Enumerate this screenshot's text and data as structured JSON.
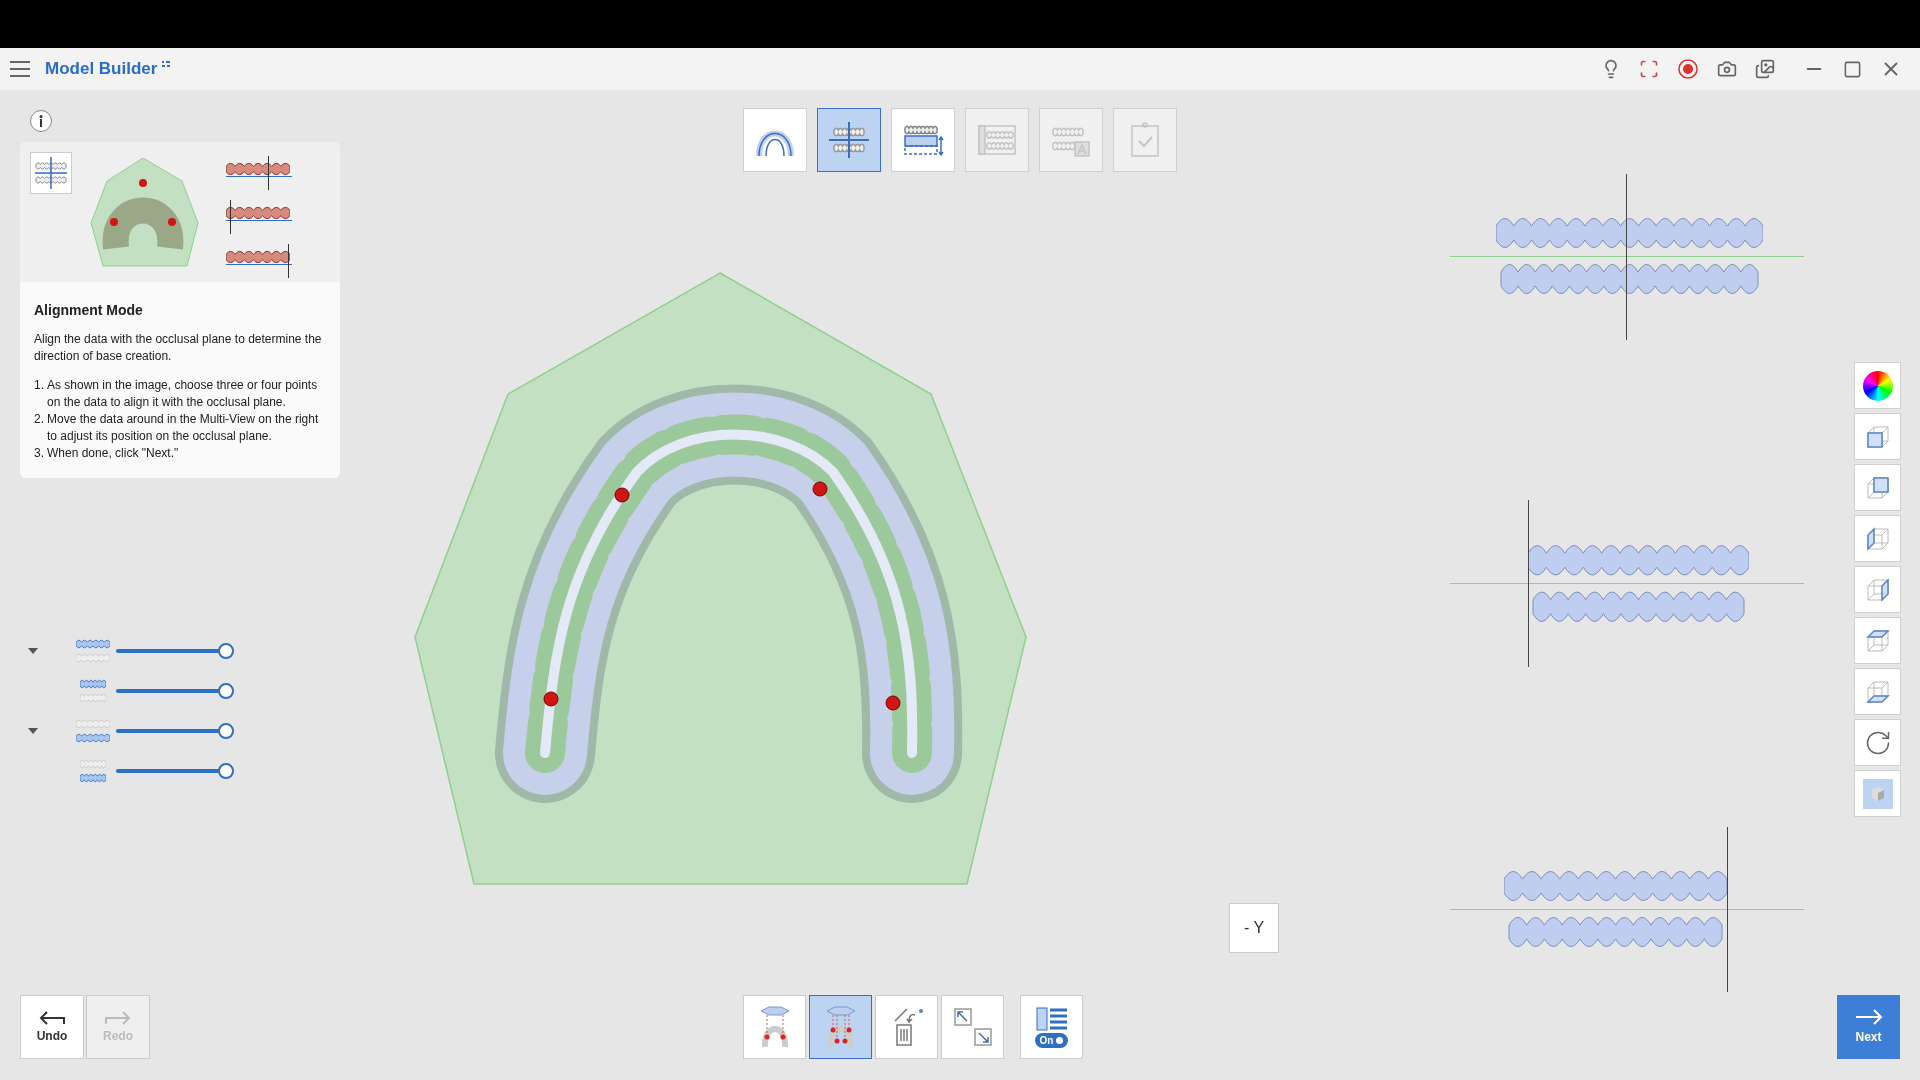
{
  "app": {
    "title": "Model Builder"
  },
  "steps": [
    {
      "selected": false,
      "disabled": false
    },
    {
      "selected": true,
      "disabled": false
    },
    {
      "selected": false,
      "disabled": false
    },
    {
      "selected": false,
      "disabled": true
    },
    {
      "selected": false,
      "disabled": true
    },
    {
      "selected": false,
      "disabled": true
    }
  ],
  "guide": {
    "title": "Alignment Mode",
    "description": "Align the data with the occlusal plane to determine the direction of base creation.",
    "steps": [
      {
        "number": "1.",
        "text": "As shown in the image, choose three or four points on the data to align it with the occlusal plane."
      },
      {
        "number": "2.",
        "text": "Move the data around in the Multi-View on the right to adjust its position on the occlusal plane."
      },
      {
        "number": "3.",
        "text": "When done, click \"Next.\""
      }
    ]
  },
  "layers": [
    {
      "kind": "group",
      "expanded": true,
      "level": 1
    },
    {
      "kind": "item",
      "level": 1
    },
    {
      "kind": "group",
      "expanded": true,
      "level": 1
    },
    {
      "kind": "item",
      "level": 1
    }
  ],
  "view_label": "- Y",
  "history": [
    {
      "label": "Undo",
      "disabled": false
    },
    {
      "label": "Redo",
      "disabled": true
    }
  ],
  "tools": [
    {
      "selected": false
    },
    {
      "selected": true
    },
    {
      "selected": false
    },
    {
      "selected": false
    }
  ],
  "list_toggle": {
    "label": "On",
    "on": true
  },
  "next": {
    "label": "Next"
  }
}
